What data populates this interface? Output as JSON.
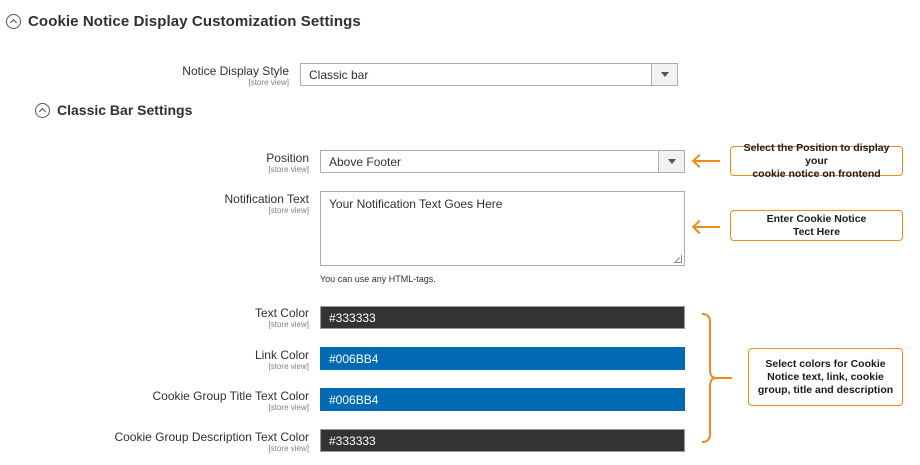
{
  "section": {
    "title": "Cookie Notice Display Customization Settings"
  },
  "display_style": {
    "label": "Notice Display Style",
    "scope": "[store view]",
    "value": "Classic bar"
  },
  "classic_bar": {
    "title": "Classic Bar Settings"
  },
  "position": {
    "label": "Position",
    "scope": "[store view]",
    "value": "Above Footer"
  },
  "notification": {
    "label": "Notification Text",
    "scope": "[store view]",
    "value": "Your Notification Text Goes Here",
    "note": "You can use any HTML-tags."
  },
  "colors": [
    {
      "label": "Text Color",
      "scope": "[store view]",
      "value": "#333333",
      "swatch": "#333333"
    },
    {
      "label": "Link Color",
      "scope": "[store view]",
      "value": "#006BB4",
      "swatch": "#006BB4"
    },
    {
      "label": "Cookie Group Title Text Color",
      "scope": "[store view]",
      "value": "#006BB4",
      "swatch": "#006BB4"
    },
    {
      "label": "Cookie Group Description Text Color",
      "scope": "[store view]",
      "value": "#333333",
      "swatch": "#333333"
    }
  ],
  "callouts": {
    "position_line1": "Select the Position to display your",
    "position_line2": "cookie notice on frontend",
    "notice_line1": "Enter Cookie Notice",
    "notice_line2": "Tect Here",
    "colors_line1": "Select colors for Cookie",
    "colors_line2": "Notice text, link, cookie",
    "colors_line3": "group, title and description"
  },
  "accent_color": "#F08B16"
}
